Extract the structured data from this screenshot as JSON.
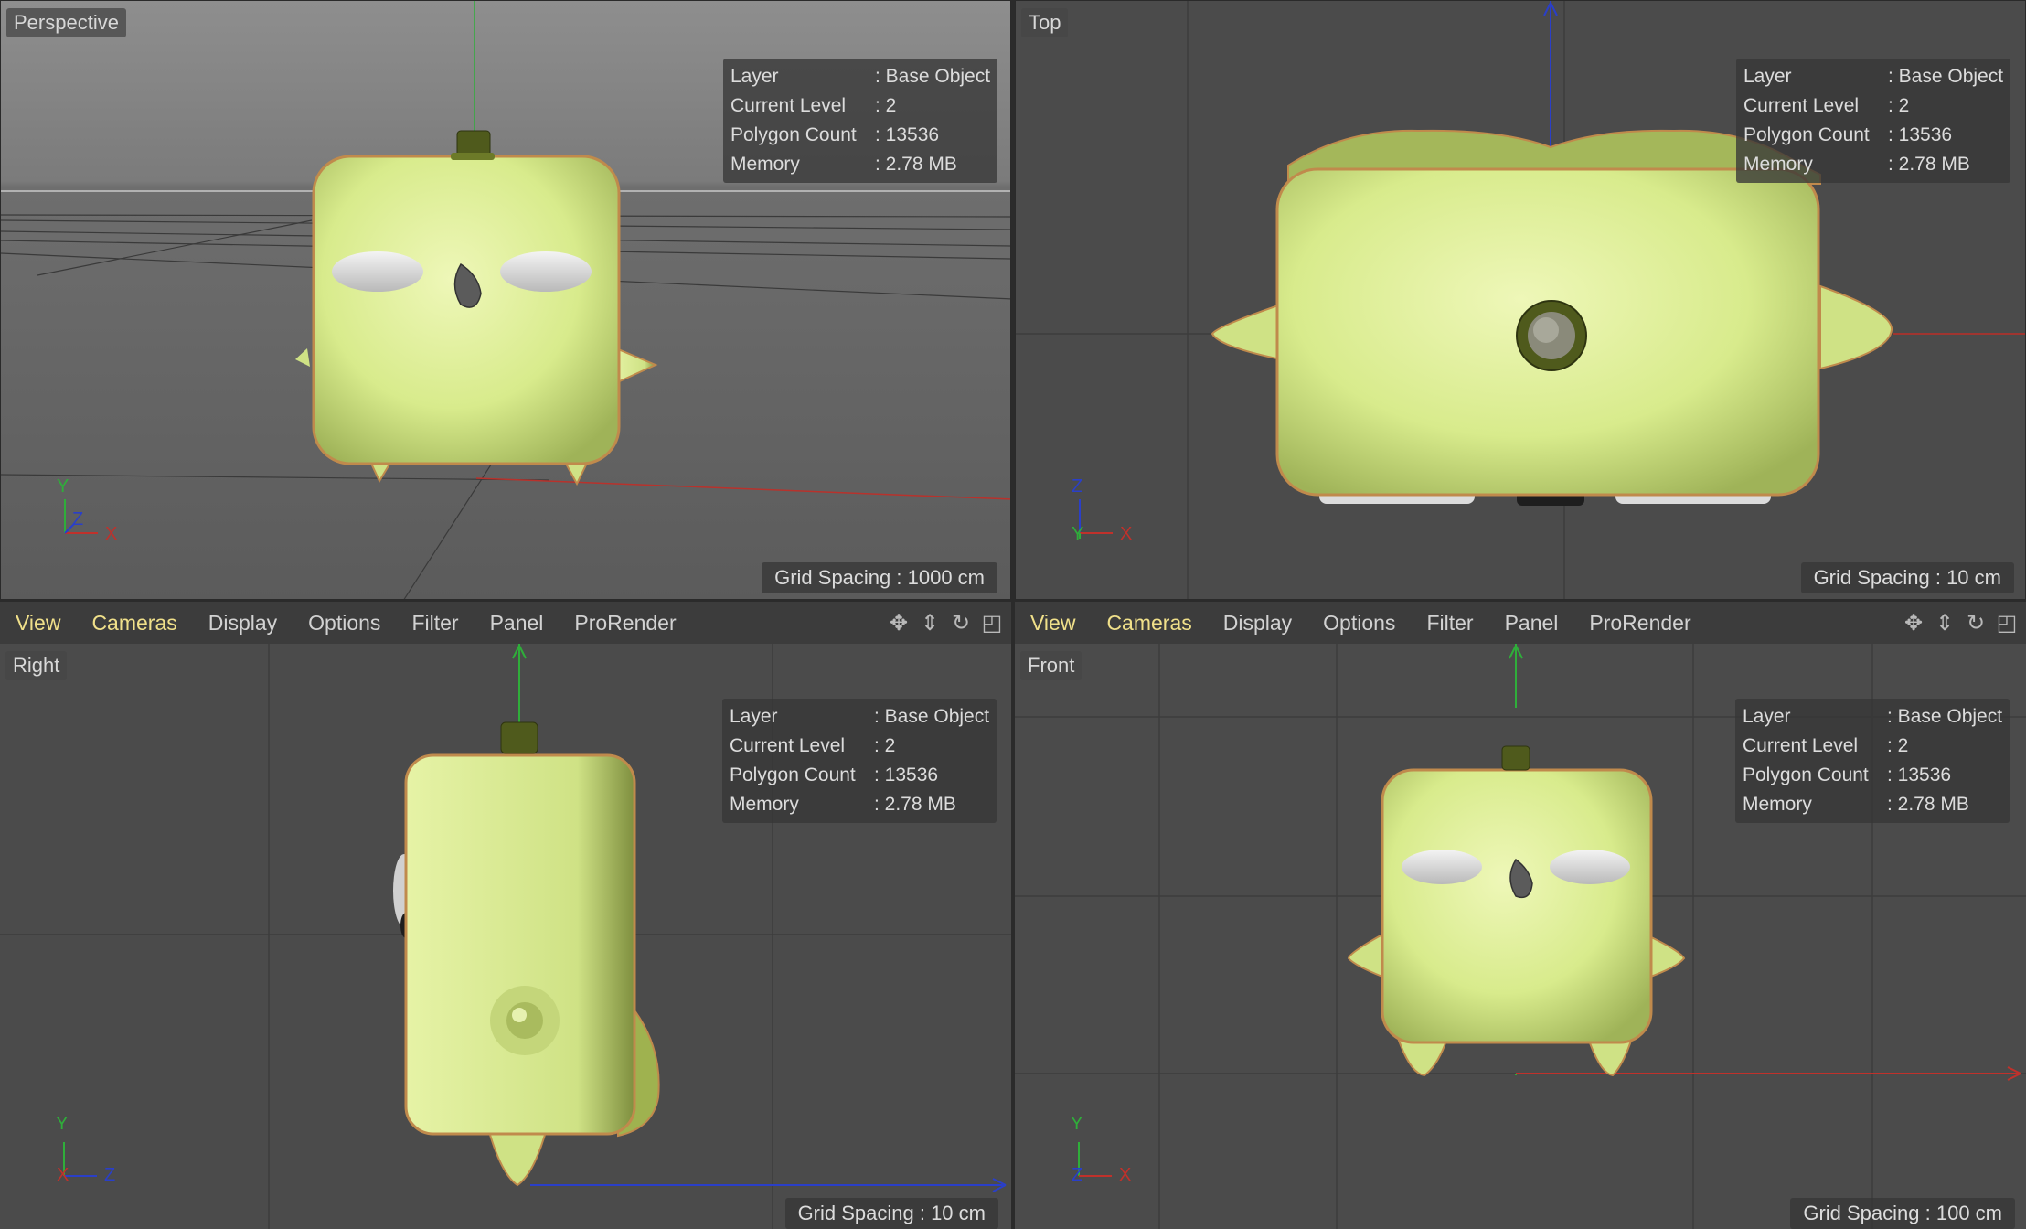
{
  "viewports": {
    "perspective": {
      "name": "Perspective",
      "grid_spacing": "Grid Spacing : 1000 cm",
      "hud": [
        {
          "k": "Layer",
          "v": ": Base Object"
        },
        {
          "k": "Current Level",
          "v": ": 2"
        },
        {
          "k": "Polygon Count",
          "v": ": 13536"
        },
        {
          "k": "Memory",
          "v": ": 2.78 MB"
        }
      ],
      "axes": {
        "y": "Y",
        "z": "Z",
        "x": "X"
      }
    },
    "top": {
      "name": "Top",
      "grid_spacing": "Grid Spacing : 10 cm",
      "hud": [
        {
          "k": "Layer",
          "v": ": Base Object"
        },
        {
          "k": "Current Level",
          "v": ": 2"
        },
        {
          "k": "Polygon Count",
          "v": ": 13536"
        },
        {
          "k": "Memory",
          "v": ": 2.78 MB"
        }
      ],
      "axes": {
        "y": "Z",
        "z": "Y",
        "x": "X"
      }
    },
    "right": {
      "name": "Right",
      "grid_spacing": "Grid Spacing : 10 cm",
      "hud": [
        {
          "k": "Layer",
          "v": ": Base Object"
        },
        {
          "k": "Current Level",
          "v": ": 2"
        },
        {
          "k": "Polygon Count",
          "v": ": 13536"
        },
        {
          "k": "Memory",
          "v": ": 2.78 MB"
        }
      ],
      "axes": {
        "y": "Y",
        "z": "X",
        "x": "Z"
      }
    },
    "front": {
      "name": "Front",
      "grid_spacing": "Grid Spacing : 100 cm",
      "hud": [
        {
          "k": "Layer",
          "v": ": Base Object"
        },
        {
          "k": "Current Level",
          "v": ": 2"
        },
        {
          "k": "Polygon Count",
          "v": ": 13536"
        },
        {
          "k": "Memory",
          "v": ": 2.78 MB"
        }
      ],
      "axes": {
        "y": "Y",
        "z": "Z",
        "x": "X"
      }
    }
  },
  "menu": {
    "view": "View",
    "cameras": "Cameras",
    "display": "Display",
    "options": "Options",
    "filter": "Filter",
    "panel": "Panel",
    "prorender": "ProRender"
  },
  "tool_icons": [
    "move-view-icon",
    "zoom-view-icon",
    "rotate-view-icon",
    "toggle-layout-icon"
  ],
  "colors": {
    "model": "#d8eb8c",
    "outline": "#c08a4c",
    "viewport_bg": "#4a4a4a",
    "axis_x": "#c0312b",
    "axis_y": "#2fae3a",
    "axis_z": "#2a3fc8",
    "menu_active": "#f0e08a"
  }
}
